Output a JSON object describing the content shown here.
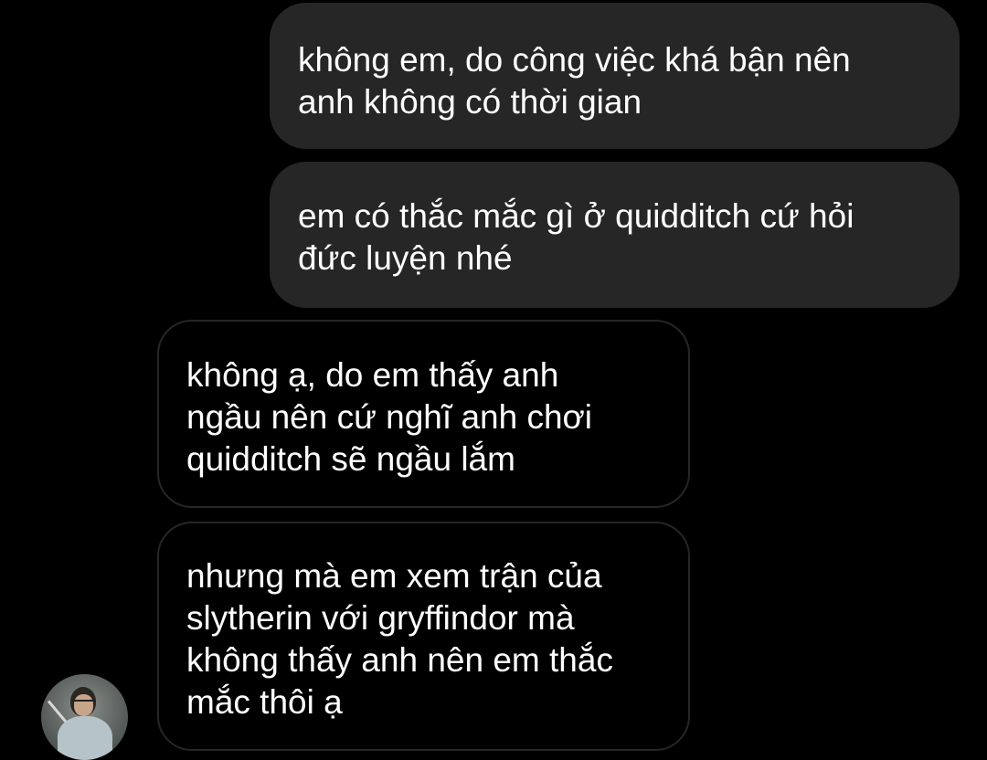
{
  "conversation": {
    "messages": [
      {
        "direction": "sent",
        "text": "không em, do công việc khá bận nên\nanh không có thời gian"
      },
      {
        "direction": "sent",
        "text": "em có thắc mắc gì ở quidditch cứ hỏi\nđức luyện nhé"
      },
      {
        "direction": "received",
        "text": "không ạ, do em thấy anh\nngầu nên cứ nghĩ anh chơi\nquidditch sẽ ngầu lắm"
      },
      {
        "direction": "received",
        "text": "nhưng mà em xem trận của\nslytherin với gryffindor mà\nkhông thấy anh nên em thắc\nmắc thôi ạ"
      }
    ]
  },
  "colors": {
    "background": "#000000",
    "sent_bubble": "#262626",
    "received_border": "#262626",
    "text": "#ffffff"
  }
}
